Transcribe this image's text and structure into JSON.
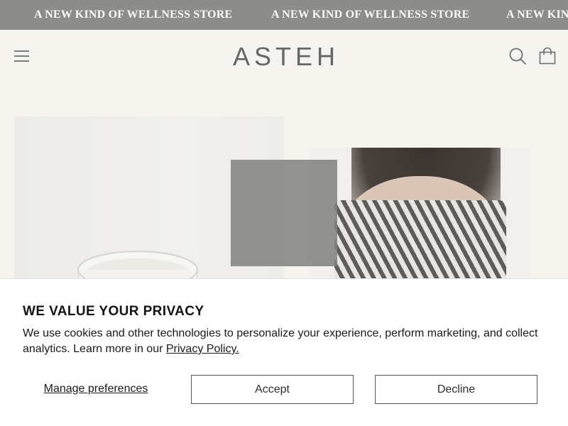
{
  "announcement": {
    "text_1": "A NEW KIND OF WELLNESS STORE",
    "text_2": "A NEW KIND OF WELLNESS STORE",
    "text_3": "A NEW KIND OF WELLNESS STORE"
  },
  "header": {
    "logo": "ASTEH",
    "menu_icon": "hamburger-menu-icon",
    "search_icon": "search-icon",
    "cart_icon": "shopping-bag-icon"
  },
  "products": {
    "product_1_image": "candle-image",
    "product_2_image": "zebra-print-top-image"
  },
  "cookie_banner": {
    "title": "WE VALUE YOUR PRIVACY",
    "text": "We use cookies and other technologies to personalize your experience, perform marketing, and collect analytics. Learn more in our ",
    "link": "Privacy Policy.",
    "manage": "Manage preferences",
    "accept": "Accept",
    "decline": "Decline"
  },
  "colors": {
    "announcement_bg": "#8c8c8a",
    "page_bg": "#f5f4ef",
    "banner_bg": "#ffffff",
    "text": "#1a1a1a"
  }
}
